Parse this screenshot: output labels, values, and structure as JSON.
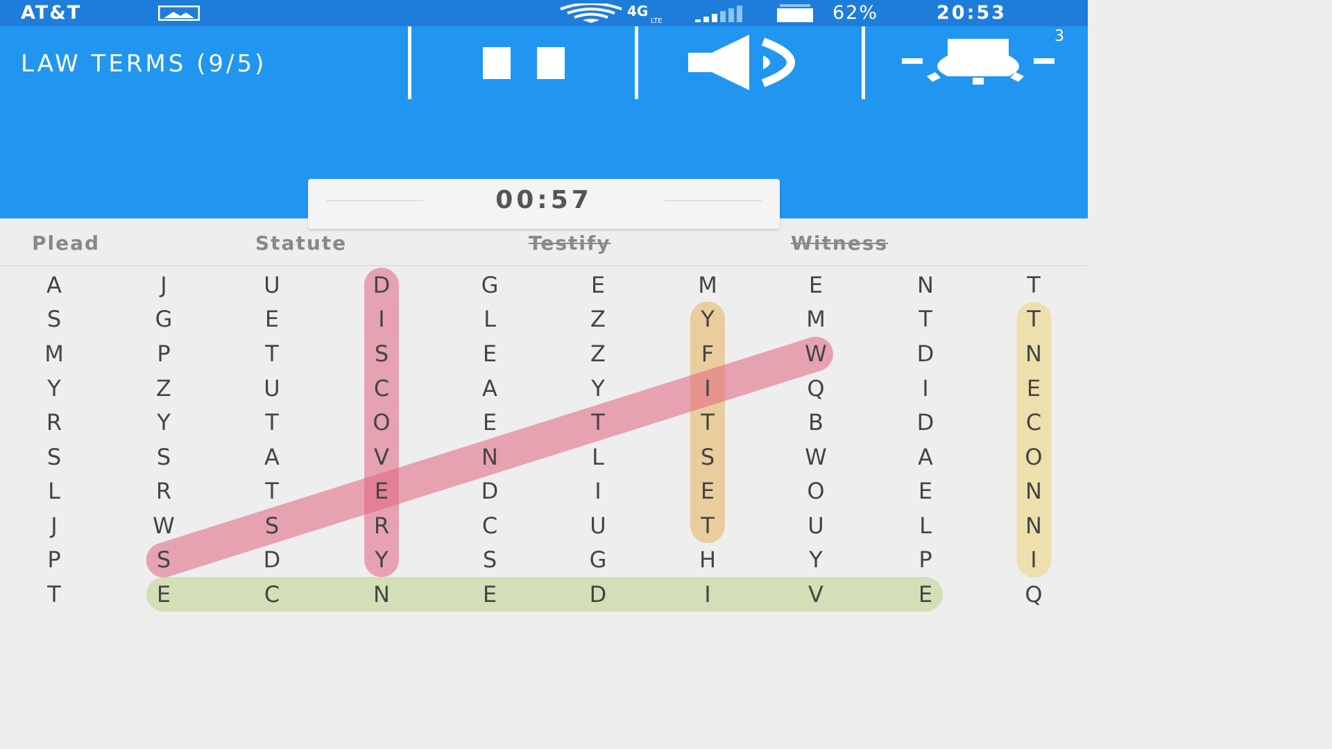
{
  "status_bar": {
    "carrier": "AT&T",
    "battery_percent": "62%",
    "time": "20:53",
    "icons": [
      "gallery-icon",
      "wifi-icon",
      "lte-icon",
      "signal-icon",
      "battery-icon"
    ]
  },
  "header": {
    "title": "LAW TERMS (9/5)",
    "hint_count": "3",
    "icons": [
      "pause-icon",
      "sound-icon",
      "hint-bulb-icon"
    ]
  },
  "timer": "00:57",
  "word_list": [
    {
      "text": "Plead",
      "found": false
    },
    {
      "text": "Statute",
      "found": false
    },
    {
      "text": "Testify",
      "found": true
    },
    {
      "text": "Witness",
      "found": true
    }
  ],
  "grid": {
    "columns": 10,
    "rows": [
      [
        "A",
        "J",
        "U",
        "D",
        "G",
        "E",
        "M",
        "E",
        "N",
        "T"
      ],
      [
        "S",
        "G",
        "E",
        "I",
        "L",
        "Z",
        "Y",
        "M",
        "T",
        "T"
      ],
      [
        "M",
        "P",
        "T",
        "S",
        "E",
        "Z",
        "F",
        "W",
        "D",
        "N"
      ],
      [
        "Y",
        "Z",
        "U",
        "C",
        "A",
        "Y",
        "I",
        "Q",
        "I",
        "E"
      ],
      [
        "R",
        "Y",
        "T",
        "O",
        "E",
        "T",
        "T",
        "B",
        "D",
        "C"
      ],
      [
        "S",
        "S",
        "A",
        "V",
        "N",
        "L",
        "S",
        "W",
        "A",
        "O"
      ],
      [
        "L",
        "R",
        "T",
        "E",
        "D",
        "I",
        "E",
        "O",
        "E",
        "N"
      ],
      [
        "J",
        "W",
        "S",
        "R",
        "C",
        "U",
        "T",
        "U",
        "L",
        "N"
      ],
      [
        "P",
        "S",
        "D",
        "Y",
        "S",
        "G",
        "H",
        "Y",
        "P",
        "I"
      ],
      [
        "T",
        "E",
        "C",
        "N",
        "E",
        "D",
        "I",
        "V",
        "E",
        "Q"
      ]
    ]
  },
  "highlights": [
    {
      "word": "DISCOVERY",
      "color": "#e06480",
      "from": [
        0,
        3
      ],
      "to": [
        8,
        3
      ]
    },
    {
      "word": "TESTIFY",
      "color": "#e8b25a",
      "from": [
        7,
        6
      ],
      "to": [
        1,
        6
      ]
    },
    {
      "word": "INNOCENT",
      "color": "#ecd678",
      "from": [
        8,
        9
      ],
      "to": [
        1,
        9
      ]
    },
    {
      "word": "EVIDENCE",
      "color": "#bed68a",
      "from": [
        9,
        8
      ],
      "to": [
        9,
        1
      ]
    },
    {
      "word": "WITNESS",
      "color": "#e06480",
      "from": [
        2,
        7
      ],
      "to": [
        8,
        1
      ]
    }
  ]
}
